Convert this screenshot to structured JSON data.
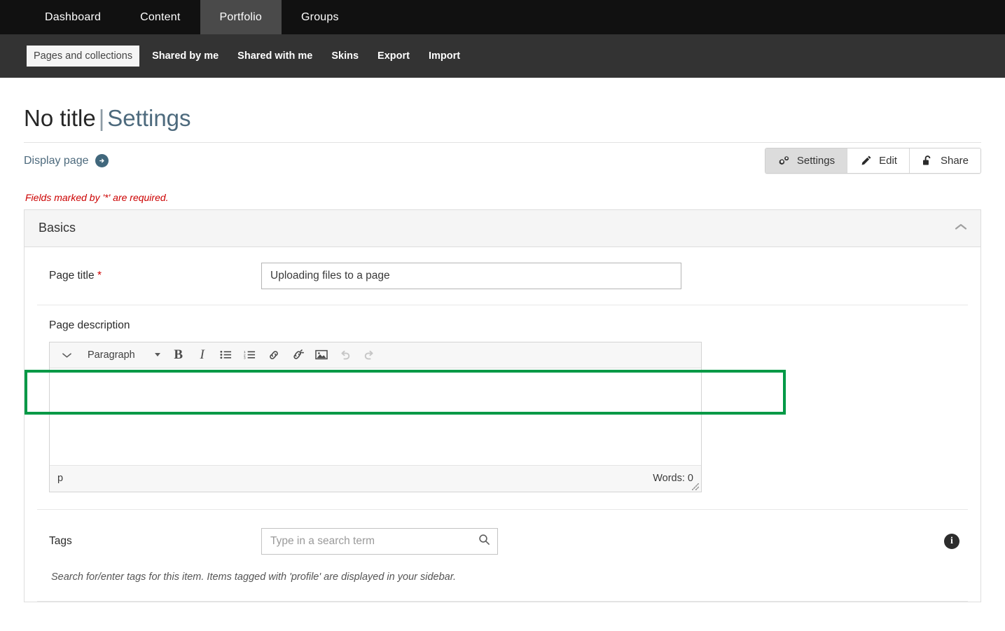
{
  "topnav": {
    "items": [
      {
        "label": "Dashboard",
        "active": false
      },
      {
        "label": "Content",
        "active": false
      },
      {
        "label": "Portfolio",
        "active": true
      },
      {
        "label": "Groups",
        "active": false
      }
    ]
  },
  "subnav": {
    "items": [
      {
        "label": "Pages and collections",
        "active": true
      },
      {
        "label": "Shared by me",
        "active": false
      },
      {
        "label": "Shared with me",
        "active": false
      },
      {
        "label": "Skins",
        "active": false
      },
      {
        "label": "Export",
        "active": false
      },
      {
        "label": "Import",
        "active": false
      }
    ]
  },
  "header": {
    "title_main": "No title",
    "title_separator": "|",
    "title_sub": "Settings",
    "display_page_label": "Display page",
    "display_page_icon": "arrow-right-circle-icon"
  },
  "actions": {
    "settings_label": "Settings",
    "settings_icon": "gears-icon",
    "edit_label": "Edit",
    "edit_icon": "pencil-icon",
    "share_label": "Share",
    "share_icon": "unlock-icon"
  },
  "required_note": "Fields marked by '*' are required.",
  "panel": {
    "title": "Basics",
    "collapse_icon": "chevron-up-icon"
  },
  "form": {
    "page_title": {
      "label": "Page title",
      "required_marker": "*",
      "value": "Uploading files to a page",
      "placeholder": ""
    },
    "page_description": {
      "label": "Page description",
      "value": ""
    },
    "tags": {
      "label": "Tags",
      "value": "",
      "placeholder": "Type in a search term",
      "search_icon": "search-icon",
      "info_icon": "info-icon",
      "help_text": "Search for/enter tags for this item. Items tagged with 'profile' are displayed in your sidebar."
    }
  },
  "editor": {
    "style_select_label": "Paragraph",
    "collapse_icon": "chevron-down-icon",
    "buttons": [
      {
        "name": "bold-icon",
        "label": "B",
        "disabled": false
      },
      {
        "name": "italic-icon",
        "label": "I",
        "disabled": false
      },
      {
        "name": "bullet-list-icon",
        "label": "",
        "disabled": false
      },
      {
        "name": "numbered-list-icon",
        "label": "",
        "disabled": false
      },
      {
        "name": "link-icon",
        "label": "",
        "disabled": false
      },
      {
        "name": "unlink-icon",
        "label": "",
        "disabled": false
      },
      {
        "name": "image-icon",
        "label": "",
        "disabled": false
      },
      {
        "name": "undo-icon",
        "label": "",
        "disabled": true
      },
      {
        "name": "redo-icon",
        "label": "",
        "disabled": true
      }
    ],
    "status_path": "p",
    "word_count": "Words: 0"
  },
  "annotation": {
    "highlight_color": "#009946",
    "target": "page-title-row"
  },
  "colors": {
    "topnav_bg": "#111111",
    "topnav_active_bg": "#4a4a4a",
    "subnav_bg": "#333333",
    "accent_slate": "#4d6a7d",
    "required_red": "#cc0000",
    "highlight_green": "#009946"
  }
}
